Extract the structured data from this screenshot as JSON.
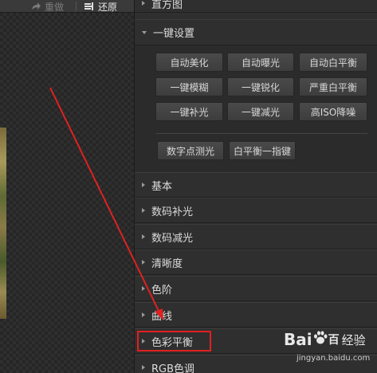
{
  "toolbar": {
    "redo_label": "重做",
    "undo_label": "还原"
  },
  "panel": {
    "histogram_label": "直方图",
    "one_click_label": "一键设置",
    "one_click_buttons": [
      "自动美化",
      "自动曝光",
      "自动白平衡",
      "一键模糊",
      "一键锐化",
      "严重白平衡",
      "一键补光",
      "一键减光",
      "高ISO降噪",
      "数字点测光",
      "白平衡一指键"
    ],
    "sections": [
      "基本",
      "数码补光",
      "数码减光",
      "清晰度",
      "色阶",
      "曲线",
      "色彩平衡",
      "RGB色调"
    ]
  },
  "watermark": {
    "logo_left": "Bai",
    "logo_right": "百",
    "logo_cn": "经验",
    "url": "jingyan.baidu.com"
  },
  "colors": {
    "highlight": "#e02020",
    "arrow": "#dd2222"
  }
}
